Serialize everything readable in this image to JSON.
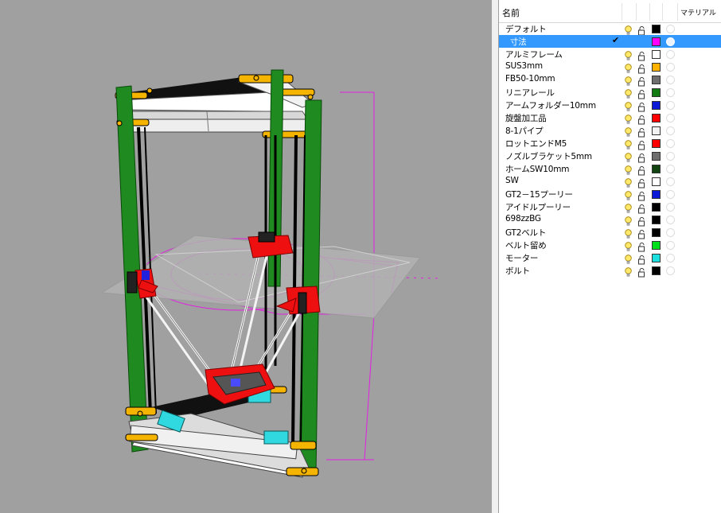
{
  "panel": {
    "header_name": "名前",
    "header_material": "マテリアル",
    "layers": [
      {
        "name": "デフォルト",
        "color": "#000000",
        "current": false,
        "selected": false
      },
      {
        "name": "寸法",
        "color": "#ff00ff",
        "current": true,
        "selected": true
      },
      {
        "name": "アルミフレーム",
        "color": "#ffffff",
        "current": false,
        "selected": false
      },
      {
        "name": "SUS3mm",
        "color": "#ffb300",
        "current": false,
        "selected": false
      },
      {
        "name": "FB50-10mm",
        "color": "#6e6e6e",
        "current": false,
        "selected": false
      },
      {
        "name": "リニアレール",
        "color": "#117a11",
        "current": false,
        "selected": false
      },
      {
        "name": "アームフォルダー10mm",
        "color": "#0a1ad6",
        "current": false,
        "selected": false
      },
      {
        "name": "旋盤加工品",
        "color": "#ff0000",
        "current": false,
        "selected": false
      },
      {
        "name": "8-1パイプ",
        "color": "#f2f2f2",
        "current": false,
        "selected": false
      },
      {
        "name": "ロットエンドM5",
        "color": "#ff0000",
        "current": false,
        "selected": false
      },
      {
        "name": "ノズルブラケット5mm",
        "color": "#6e6e6e",
        "current": false,
        "selected": false
      },
      {
        "name": "ホームSW10mm",
        "color": "#124512",
        "current": false,
        "selected": false
      },
      {
        "name": "SW",
        "color": "#ffffff",
        "current": false,
        "selected": false
      },
      {
        "name": "GT2－15プーリー",
        "color": "#0a1ad6",
        "current": false,
        "selected": false
      },
      {
        "name": "アイドルプーリー",
        "color": "#000000",
        "current": false,
        "selected": false
      },
      {
        "name": "698zzBG",
        "color": "#000000",
        "current": false,
        "selected": false
      },
      {
        "name": "GT2ベルト",
        "color": "#000000",
        "current": false,
        "selected": false
      },
      {
        "name": "ベルト留め",
        "color": "#00e01a",
        "current": false,
        "selected": false
      },
      {
        "name": "モーター",
        "color": "#1ce0e0",
        "current": false,
        "selected": false
      },
      {
        "name": "ボルト",
        "color": "#000000",
        "current": false,
        "selected": false
      }
    ]
  }
}
